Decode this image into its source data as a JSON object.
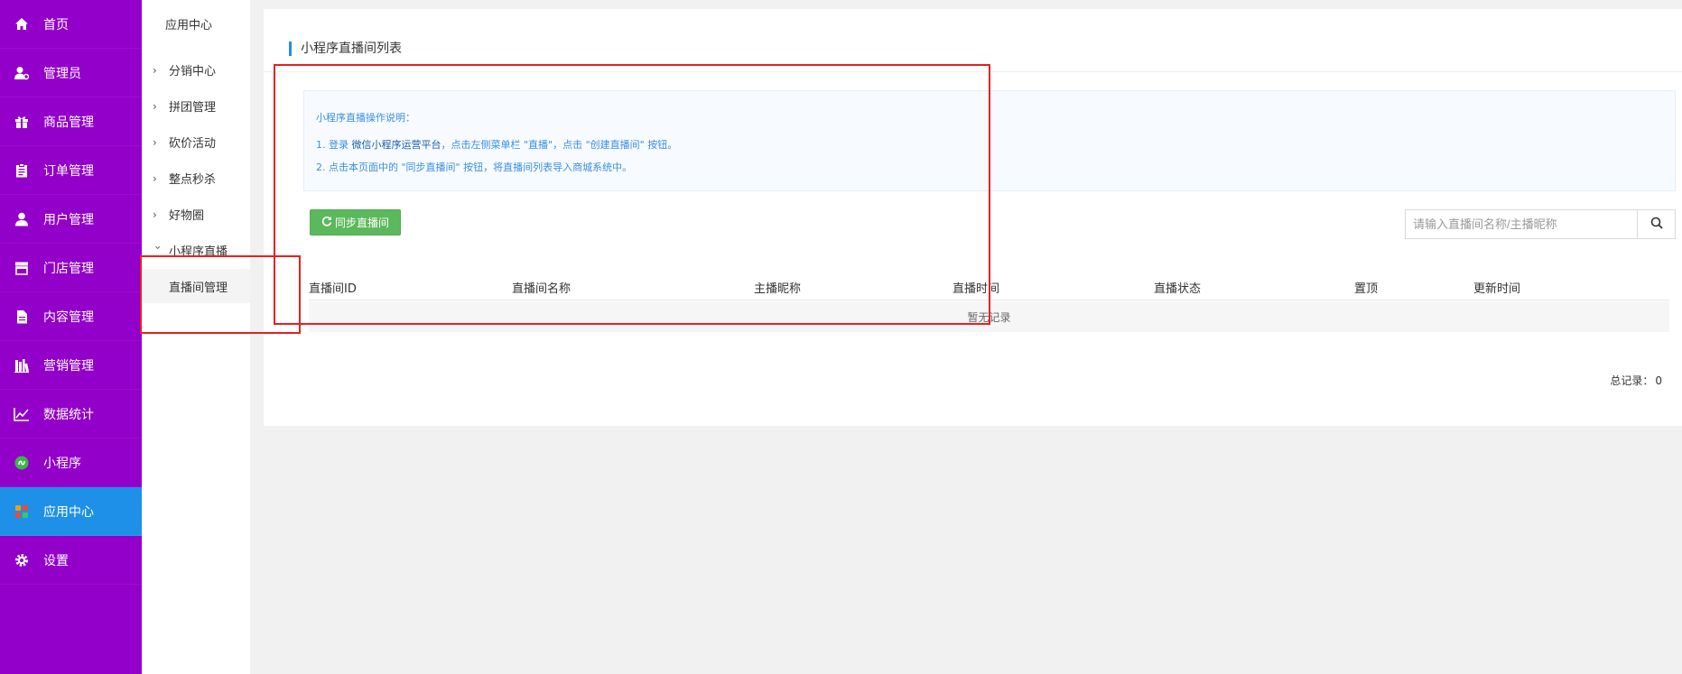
{
  "sidebar": {
    "items": [
      {
        "label": "首页",
        "icon": "home-icon"
      },
      {
        "label": "管理员",
        "icon": "admin-icon"
      },
      {
        "label": "商品管理",
        "icon": "gift-icon"
      },
      {
        "label": "订单管理",
        "icon": "clipboard-icon"
      },
      {
        "label": "用户管理",
        "icon": "user-icon"
      },
      {
        "label": "门店管理",
        "icon": "store-icon"
      },
      {
        "label": "内容管理",
        "icon": "document-icon"
      },
      {
        "label": "营销管理",
        "icon": "books-icon"
      },
      {
        "label": "数据统计",
        "icon": "line-chart-icon"
      },
      {
        "label": "小程序",
        "icon": "mini-program-icon"
      },
      {
        "label": "应用中心",
        "icon": "apps-icon",
        "active": true
      },
      {
        "label": "设置",
        "icon": "gear-icon"
      }
    ],
    "colors": {
      "background": "#9300c9",
      "active": "#1e90e8"
    }
  },
  "submenu": {
    "title": "应用中心",
    "items": [
      {
        "label": "分销中心"
      },
      {
        "label": "拼团管理"
      },
      {
        "label": "砍价活动"
      },
      {
        "label": "整点秒杀"
      },
      {
        "label": "好物圈"
      },
      {
        "label": "小程序直播",
        "expanded": true
      }
    ],
    "child": {
      "label": "直播间管理"
    }
  },
  "main": {
    "title": "小程序直播间列表",
    "notice": {
      "title": "小程序直播操作说明：",
      "line1_a": "1. 登录 ",
      "line1_b": "微信小程序运营平台",
      "line1_c": "，点击左侧菜单栏 \"直播\"，点击 \"创建直播间\" 按钮。",
      "line2": "2. 点击本页面中的 \"同步直播间\" 按钮，将直播间列表导入商城系统中。"
    },
    "sync_button": "同步直播间",
    "search": {
      "placeholder": "请输入直播间名称/主播昵称",
      "value": ""
    },
    "table": {
      "headers": [
        "直播间ID",
        "直播间名称",
        "主播昵称",
        "直播时间",
        "直播状态",
        "置顶",
        "更新时间"
      ],
      "empty_text": "暂无记录"
    },
    "total": {
      "label": "总记录：",
      "value": "0"
    }
  },
  "colors": {
    "accent": "#1e90e8",
    "success_button": "#5cb85c",
    "annotation": "#e82020",
    "notice_text": "#3a8ee6"
  }
}
